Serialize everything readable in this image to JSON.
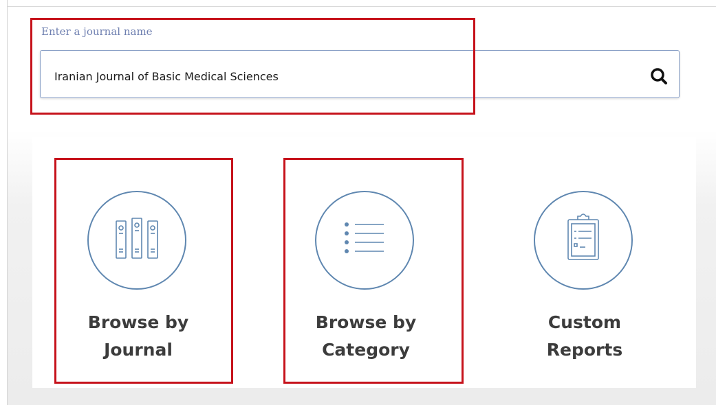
{
  "search": {
    "label": "Enter a journal name",
    "value": "Iranian Journal of Basic Medical Sciences",
    "button_icon": "search-icon"
  },
  "cards": [
    {
      "line1": "Browse by",
      "line2": "Journal",
      "icon": "books-icon"
    },
    {
      "line1": "Browse by",
      "line2": "Category",
      "icon": "list-icon"
    },
    {
      "line1": "Custom",
      "line2": "Reports",
      "icon": "clipboard-icon"
    }
  ],
  "colors": {
    "highlight": "#c6121b",
    "icon_stroke": "#5f87b0",
    "label_text": "#3c3c3c",
    "search_label": "#6e7fb0"
  }
}
